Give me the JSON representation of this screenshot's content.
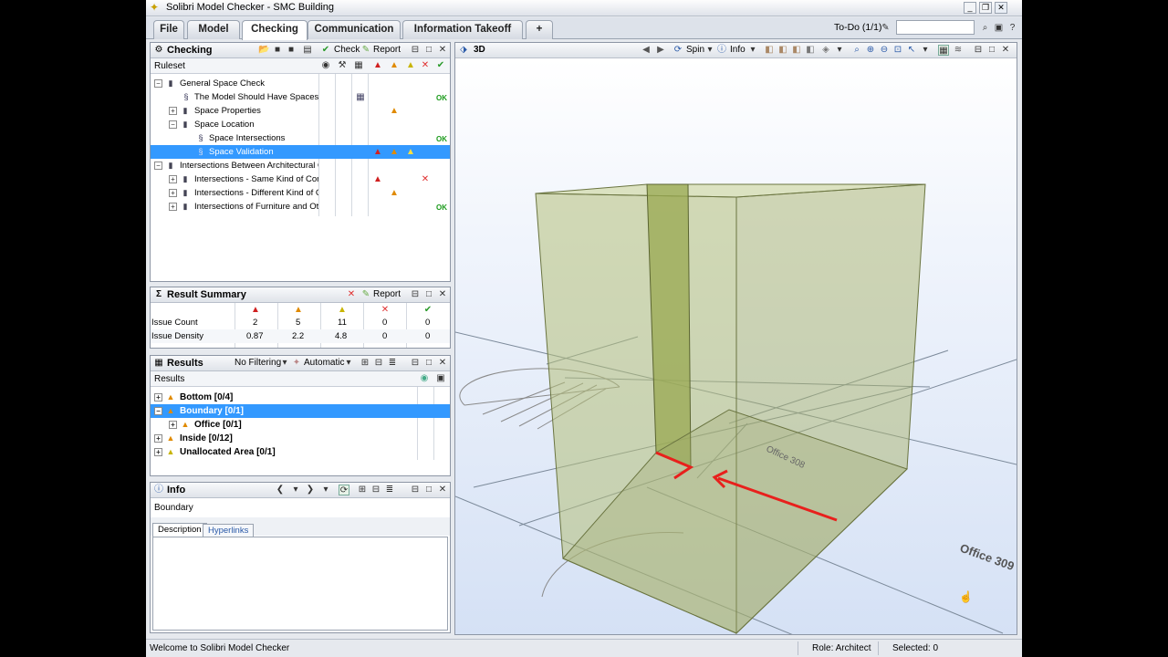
{
  "window": {
    "title": "Solibri Model Checker - SMC Building"
  },
  "menu": {
    "tabs": [
      "File",
      "Model",
      "Checking",
      "Communication",
      "Information Takeoff",
      "+"
    ],
    "active": "Checking",
    "todo_label": "To-Do (1/1)"
  },
  "checking": {
    "title": "Checking",
    "check_label": "Check",
    "report_label": "Report",
    "column_header": "Ruleset",
    "rows": [
      {
        "label": "General Space Check",
        "ok": ""
      },
      {
        "label": "The Model Should Have Spaces",
        "ok": "OK"
      },
      {
        "label": "Space Properties",
        "ok": ""
      },
      {
        "label": "Space Location",
        "ok": ""
      },
      {
        "label": "Space Intersections",
        "ok": "OK"
      },
      {
        "label": "Space Validation",
        "ok": ""
      },
      {
        "label": "Intersections Between Architectural C",
        "ok": ""
      },
      {
        "label": "Intersections - Same Kind of Comp",
        "ok": ""
      },
      {
        "label": "Intersections - Different Kind of C",
        "ok": ""
      },
      {
        "label": "Intersections of Furniture and Oth",
        "ok": "OK"
      }
    ]
  },
  "summary": {
    "title": "Result Summary",
    "report_label": "Report",
    "rows": [
      {
        "label": "Issue Count",
        "values": [
          "2",
          "5",
          "11",
          "0",
          "0"
        ]
      },
      {
        "label": "Issue Density",
        "values": [
          "0.87",
          "2.2",
          "4.8",
          "0",
          "0"
        ]
      }
    ]
  },
  "results": {
    "title": "Results",
    "filter_label": "No Filtering",
    "mode_label": "Automatic",
    "column_header": "Results",
    "items": [
      {
        "label": "Bottom [0/4]"
      },
      {
        "label": "Boundary [0/1]"
      },
      {
        "label": "Office [0/1]"
      },
      {
        "label": "Inside [0/12]"
      },
      {
        "label": "Unallocated Area [0/1]"
      }
    ]
  },
  "info": {
    "title": "Info",
    "subject": "Boundary",
    "tabs": [
      "Description",
      "Hyperlinks"
    ]
  },
  "view3d": {
    "title": "3D",
    "spin_label": "Spin",
    "info_label": "Info",
    "space_labels": [
      "Office 308",
      "Office 309"
    ]
  },
  "status": {
    "welcome": "Welcome to Solibri Model Checker",
    "role": "Role: Architect",
    "selected": "Selected: 0"
  },
  "colors": {
    "selection": "#3399ff",
    "issue_arrow": "#e8201c",
    "space_fill": "#b4c07a"
  }
}
